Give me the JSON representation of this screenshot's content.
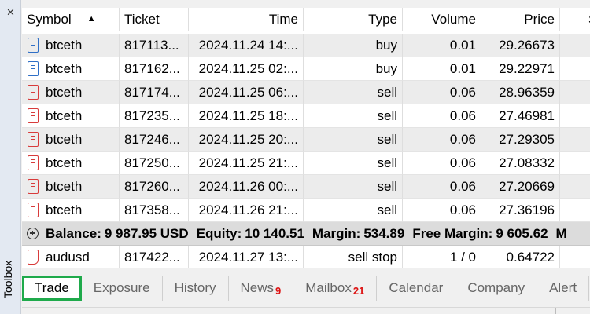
{
  "toolbox": {
    "label": "Toolbox",
    "close_glyph": "×"
  },
  "columns": {
    "symbol": "Symbol",
    "ticket": "Ticket",
    "time": "Time",
    "type": "Type",
    "volume": "Volume",
    "price": "Price",
    "sl": "S /"
  },
  "rows": [
    {
      "icon": "buy-order-icon",
      "symbol": "btceth",
      "ticket": "817113...",
      "time": "2024.11.24 14:...",
      "type": "buy",
      "volume": "0.01",
      "price": "29.26673"
    },
    {
      "icon": "buy-order-icon",
      "symbol": "btceth",
      "ticket": "817162...",
      "time": "2024.11.25 02:...",
      "type": "buy",
      "volume": "0.01",
      "price": "29.22971"
    },
    {
      "icon": "sell-order-icon",
      "symbol": "btceth",
      "ticket": "817174...",
      "time": "2024.11.25 06:...",
      "type": "sell",
      "volume": "0.06",
      "price": "28.96359"
    },
    {
      "icon": "sell-order-icon",
      "symbol": "btceth",
      "ticket": "817235...",
      "time": "2024.11.25 18:...",
      "type": "sell",
      "volume": "0.06",
      "price": "27.46981"
    },
    {
      "icon": "sell-order-icon",
      "symbol": "btceth",
      "ticket": "817246...",
      "time": "2024.11.25 20:...",
      "type": "sell",
      "volume": "0.06",
      "price": "27.29305"
    },
    {
      "icon": "sell-order-icon",
      "symbol": "btceth",
      "ticket": "817250...",
      "time": "2024.11.25 21:...",
      "type": "sell",
      "volume": "0.06",
      "price": "27.08332"
    },
    {
      "icon": "sell-order-icon",
      "symbol": "btceth",
      "ticket": "817260...",
      "time": "2024.11.26 00:...",
      "type": "sell",
      "volume": "0.06",
      "price": "27.20669"
    },
    {
      "icon": "sell-order-icon",
      "symbol": "btceth",
      "ticket": "817358...",
      "time": "2024.11.26 21:...",
      "type": "sell",
      "volume": "0.06",
      "price": "27.36196"
    }
  ],
  "balance": {
    "balance_label": "Balance:",
    "balance_value": "9 987.95 USD",
    "equity_label": "Equity:",
    "equity_value": "10 140.51",
    "margin_label": "Margin:",
    "margin_value": "534.89",
    "free_margin_label": "Free Margin:",
    "free_margin_value": "9 605.62",
    "trailing": "M"
  },
  "pending": {
    "icon": "pending-order-icon",
    "symbol": "audusd",
    "ticket": "817422...",
    "time": "2024.11.27 13:...",
    "type": "sell stop",
    "volume": "1 / 0",
    "price": "0.64722"
  },
  "tabs": [
    {
      "label": "Trade",
      "active": true
    },
    {
      "label": "Exposure"
    },
    {
      "label": "History"
    },
    {
      "label": "News",
      "badge": "9"
    },
    {
      "label": "Mailbox",
      "badge": "21"
    },
    {
      "label": "Calendar"
    },
    {
      "label": "Company"
    },
    {
      "label": "Alert"
    }
  ],
  "colors": {
    "active_tab_border": "#1faa4b",
    "buy_icon": "#2f6fc6",
    "sell_icon": "#d83b3b",
    "badge": "#dd1111"
  }
}
